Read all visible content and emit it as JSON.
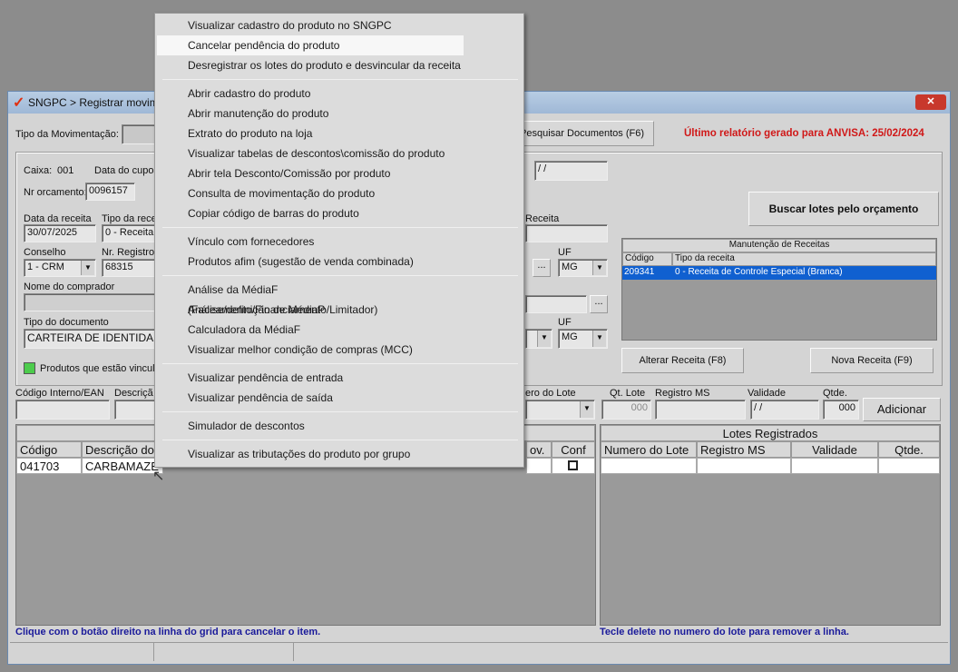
{
  "window": {
    "title": "SNGPC > Registrar movim",
    "close": "✕"
  },
  "top": {
    "tipo_mov_label": "Tipo da Movimentação:",
    "pesquisar_btn": "Pesquisar Documentos (F6)",
    "ultimo_relatorio": "Último relatório gerado para ANVISA: 25/02/2024"
  },
  "form": {
    "caixa_label": "Caixa:",
    "caixa_value": "001",
    "data_cupom_label": "Data do cupo",
    "data_cupom_value": "/ /",
    "nr_orcamento_label": "Nr orcamento:",
    "nr_orcamento_value": "0096157",
    "data_receita_label": "Data da receita",
    "data_receita_value": "30/07/2025",
    "tipo_receita_label": "Tipo da rece",
    "tipo_receita_value": "0 - Receita",
    "conselho_label": "Conselho",
    "conselho_value": "1 - CRM",
    "nr_registro_label": "Nr. Registro",
    "nr_registro_value": "68315",
    "nome_comprador_label": "Nome do comprador",
    "tipo_documento_label": "Tipo do documento",
    "tipo_documento_value": "CARTEIRA DE IDENTIDADE",
    "receita_label": "Receita",
    "uf_label": "UF",
    "uf_value": "MG",
    "uf2_label": "UF",
    "uf2_value": "MG",
    "ellipsis": "...",
    "legend_text": "Produtos que estão vincula"
  },
  "buscar_btn": "Buscar lotes pelo orçamento",
  "receitas": {
    "title": "Manutenção de Receitas",
    "columns": [
      "Código",
      "Tipo da receita"
    ],
    "rows": [
      [
        "209341",
        "0 - Receita de Controle Especial (Branca)"
      ]
    ]
  },
  "alterar_btn": "Alterar Receita (F8)",
  "nova_btn": "Nova Receita (F9)",
  "item_entry": {
    "codigo_label": "Código Interno/EAN",
    "descricao_label": "Descriçã",
    "numero_lote_label": "ero do Lote",
    "qt_lote_label": "Qt. Lote",
    "qt_lote_value": "000",
    "registro_ms_label": "Registro MS",
    "validade_label": "Validade",
    "validade_value": "/ /",
    "qtde_label": "Qtde.",
    "qtde_value": "000",
    "adicionar_btn": "Adicionar"
  },
  "items_grid": {
    "columns": [
      "Código",
      "Descrição do",
      "ov.",
      "Conf"
    ],
    "rows": [
      [
        "041703",
        "CARBAMAZE"
      ]
    ]
  },
  "lotes_grid": {
    "title": "Lotes Registrados",
    "columns": [
      "Numero do Lote",
      "Registro MS",
      "Validade",
      "Qtde."
    ]
  },
  "footer": {
    "hint_left": "Clique com o botão direito na linha do grid para cancelar o item.",
    "hint_right": "Tecle delete no numero do lote para remover a linha."
  },
  "context_menu": {
    "items": [
      "Visualizar cadastro do produto no SNGPC",
      "Cancelar pendência do produto",
      "Desregistrar os lotes do produto e desvincular da receita",
      "Abrir cadastro do produto",
      "Abrir manutenção do produto",
      "Extrato do produto na loja",
      "Visualizar tabelas de descontos\\comissão do produto",
      "Abrir tela Desconto/Comissão por produto",
      "Consulta de movimentação do produto",
      "Copiar código de barras do produto",
      "Vínculo com fornecedores",
      "Produtos afim (sugestão de venda combinada)",
      "Análise da MédiaF (Faceamento/Financiamento/Limitador)",
      "Análise/definição de MédiaP",
      "Calculadora da MédiaF",
      "Visualizar melhor condição de compras (MCC)",
      "Visualizar pendência de entrada",
      "Visualizar pendência de saída",
      "Simulador de descontos",
      "Visualizar as tributações do produto por grupo"
    ],
    "highlighted": 1
  }
}
